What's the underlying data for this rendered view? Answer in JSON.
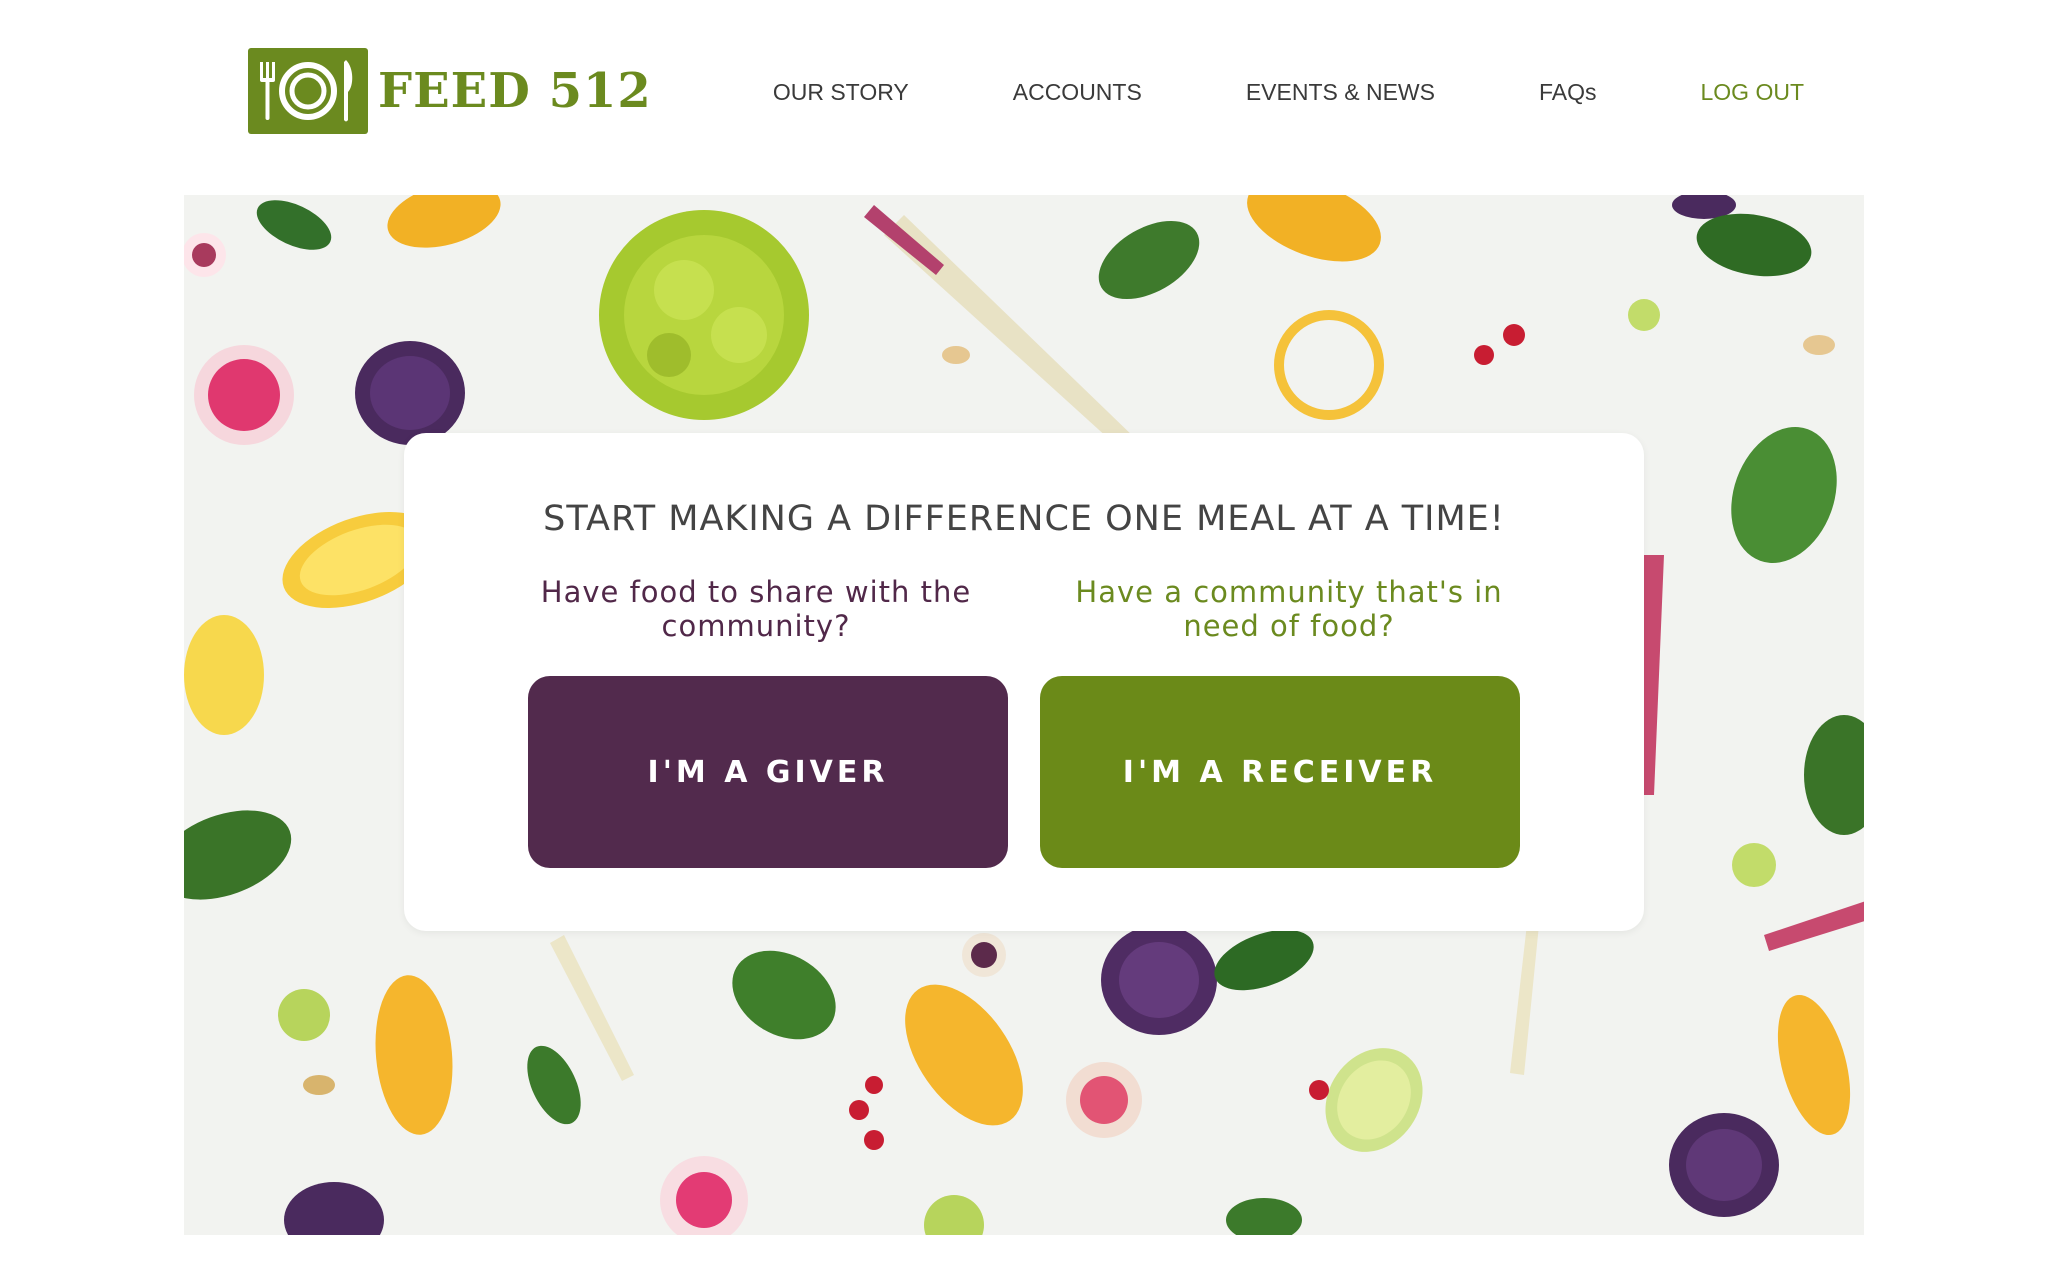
{
  "brand": {
    "name": "FEED 512",
    "logo_icon": "plate-fork-knife-icon",
    "color": "#6b8a1f"
  },
  "nav": {
    "items": [
      {
        "label": "OUR STORY"
      },
      {
        "label": "ACCOUNTS"
      },
      {
        "label": "EVENTS & NEWS"
      },
      {
        "label": "FAQs"
      },
      {
        "label": "LOG OUT"
      }
    ]
  },
  "hero": {
    "background": "fruits-and-vegetables-flatlay-image"
  },
  "card": {
    "title": "START MAKING A DIFFERENCE ONE MEAL AT A TIME!",
    "giver": {
      "prompt": "Have food to share with the community?",
      "button_label": "I'M A GIVER",
      "color": "#522a4d"
    },
    "receiver": {
      "prompt": "Have a community that's in need of food?",
      "button_label": "I'M A RECEIVER",
      "color": "#6b8a18"
    }
  }
}
